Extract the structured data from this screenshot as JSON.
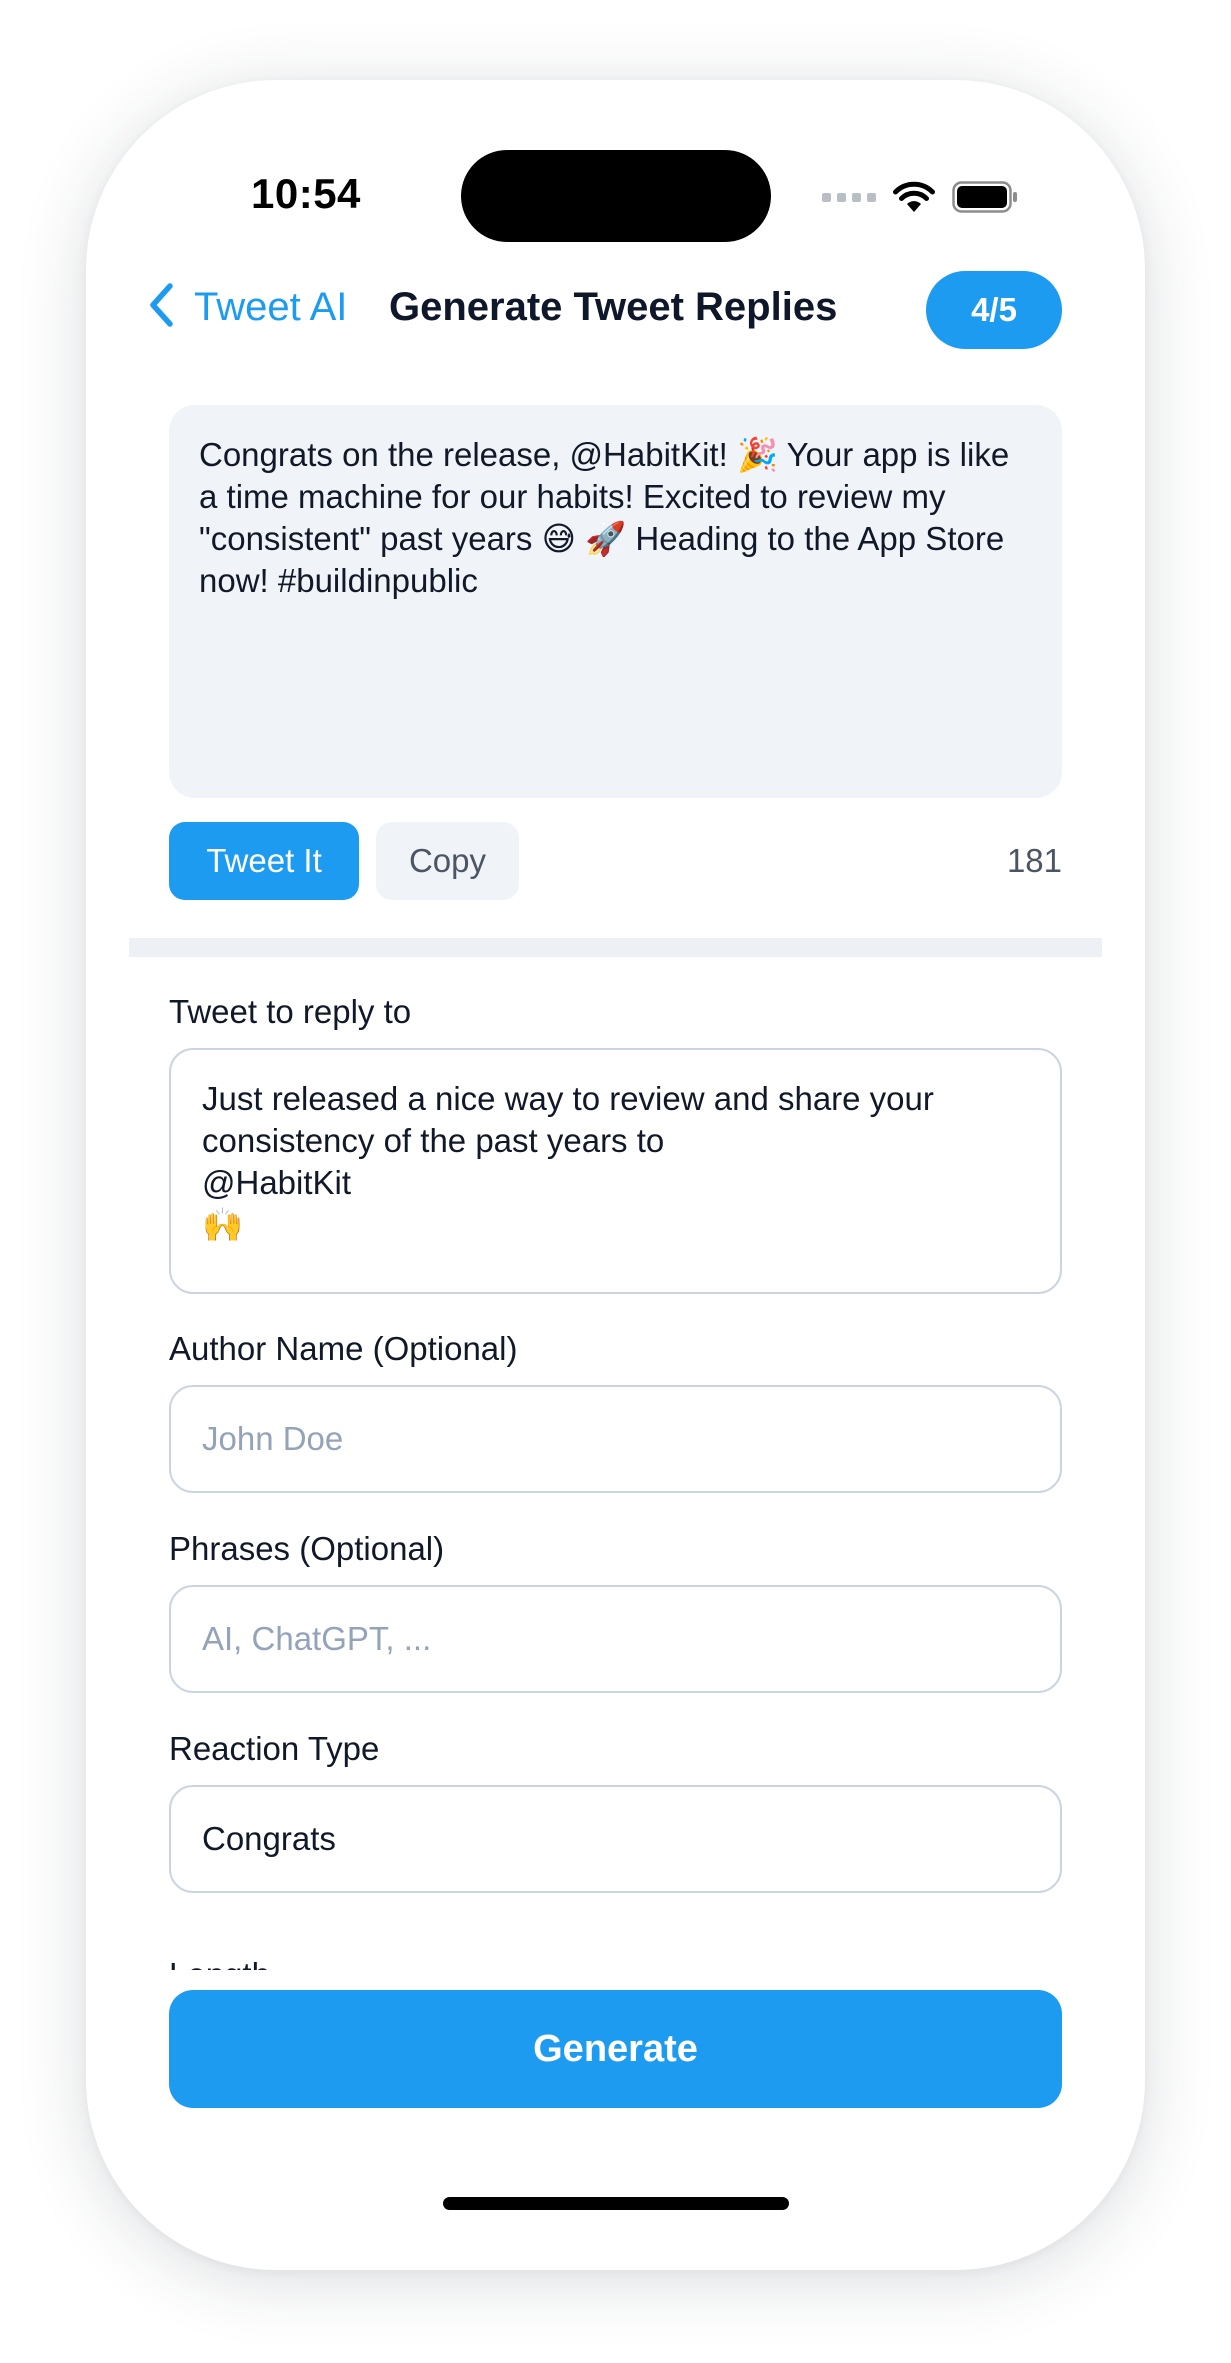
{
  "status_bar": {
    "time": "10:54"
  },
  "nav": {
    "back_label": "Tweet AI",
    "title": "Generate Tweet Replies",
    "counter": "4/5"
  },
  "generated_reply": {
    "text": "Congrats on the release, @HabitKit! 🎉 Your app is like a time machine for our habits! Excited to review my \"consistent\" past years 😅 🚀 Heading to the App Store now! #buildinpublic",
    "tweet_button": "Tweet It",
    "copy_button": "Copy",
    "char_count": "181"
  },
  "form": {
    "tweet_label": "Tweet to reply to",
    "tweet_value": "Just released a nice way to review and share your consistency of the past years to\n@HabitKit\n🙌",
    "author_label": "Author Name (Optional)",
    "author_placeholder": "John Doe",
    "phrases_label": "Phrases (Optional)",
    "phrases_placeholder": "AI, ChatGPT, ...",
    "reaction_label": "Reaction Type",
    "reaction_value": "Congrats",
    "next_label_partial": "Length"
  },
  "generate_button": "Generate",
  "colors": {
    "accent": "#1d9bf0",
    "card_bg": "#f0f3f8",
    "border": "#cbd5e1",
    "placeholder": "#94a3b8"
  }
}
